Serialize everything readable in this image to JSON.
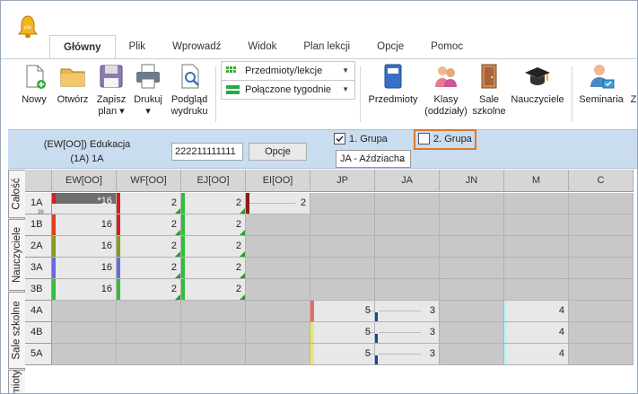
{
  "tabs": [
    "Główny",
    "Plik",
    "Wprowadź",
    "Widok",
    "Plan lekcji",
    "Opcje",
    "Pomoc"
  ],
  "active_tab": "Główny",
  "ribbon": {
    "nowy": "Nowy",
    "otworz": "Otwórz",
    "zapisz": [
      "Zapisz",
      "plan ▾"
    ],
    "drukuj": "Drukuj ▾",
    "podglad": [
      "Podgląd",
      "wydruku"
    ],
    "dropdown1": "Przedmioty/lekcje",
    "dropdown2": "Połączone tygodnie",
    "przedmioty": "Przedmioty",
    "klasy": [
      "Klasy",
      "(oddziały)"
    ],
    "sale": [
      "Sale",
      "szkolne"
    ],
    "nauczyciele": "Nauczyciele",
    "seminaria": "Seminaria",
    "z_cut": "Z"
  },
  "filter": {
    "group_line1": "(EW[OO]) Edukacja",
    "group_line2": "(1A) 1A",
    "group_input": "222211111111",
    "opcje": "Opcje",
    "grupa1": "1. Grupa",
    "grupa2": "2. Grupa",
    "jadd": "JA - Aździacha"
  },
  "vtabs": [
    "Całość",
    "Nauczyciele",
    "Sale szkolne",
    "mioty"
  ],
  "columns": [
    "EW[OO]",
    "WF[OO]",
    "EJ[OO]",
    "EI[OO]",
    "JP",
    "JA",
    "JN",
    "M",
    "C"
  ],
  "rows": [
    {
      "label": "1A",
      "sub": "36",
      "cells": [
        "*16",
        "2",
        "2",
        "2",
        "",
        "",
        "",
        "",
        ""
      ]
    },
    {
      "label": "1B",
      "cells": [
        "16",
        "2",
        "2",
        "",
        "",
        "",
        "",
        "",
        ""
      ]
    },
    {
      "label": "2A",
      "cells": [
        "16",
        "2",
        "2",
        "",
        "",
        "",
        "",
        "",
        ""
      ]
    },
    {
      "label": "3A",
      "cells": [
        "16",
        "2",
        "2",
        "",
        "",
        "",
        "",
        "",
        ""
      ]
    },
    {
      "label": "3B",
      "cells": [
        "16",
        "2",
        "2",
        "",
        "",
        "",
        "",
        "",
        ""
      ]
    },
    {
      "label": "4A",
      "cells": [
        "",
        "",
        "",
        "",
        "5",
        "3",
        "",
        "4",
        ""
      ]
    },
    {
      "label": "4B",
      "cells": [
        "",
        "",
        "",
        "",
        "5",
        "3",
        "",
        "4",
        ""
      ]
    },
    {
      "label": "5A",
      "cells": [
        "",
        "",
        "",
        "",
        "5",
        "3",
        "",
        "4",
        ""
      ]
    }
  ],
  "colors": {
    "bar_red": "#d22020",
    "bar_blue": "#5a6ee6",
    "bar_green": "#2fbf3a",
    "bar_olive": "#8a9a1a",
    "bar_yellow": "#e8e86a",
    "bar_cyan": "#aef0f0",
    "highlight": "#d9782f"
  }
}
